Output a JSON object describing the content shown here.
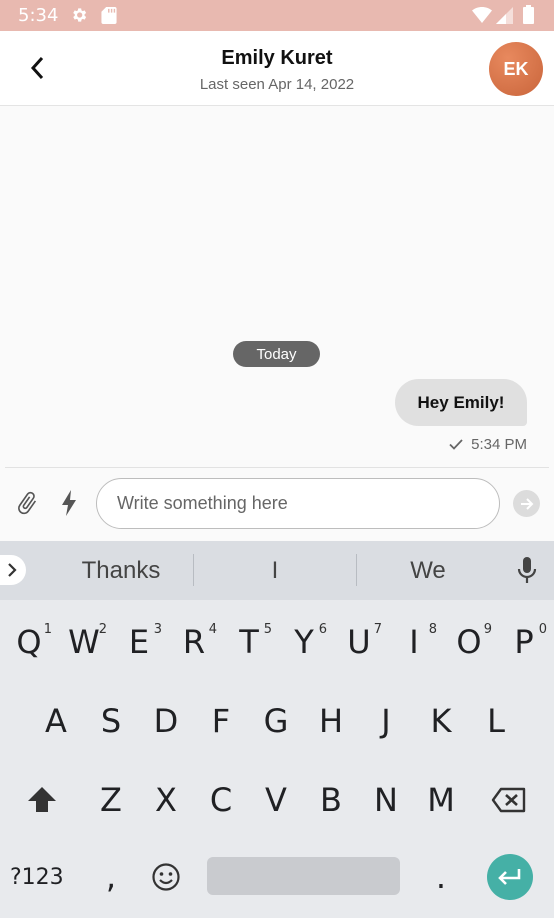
{
  "status_bar": {
    "time": "5:34",
    "icons": [
      "gear-icon",
      "sd-card-icon",
      "wifi-icon",
      "signal-icon",
      "battery-icon"
    ],
    "background": "#e8b9b0"
  },
  "header": {
    "back_icon": "chevron-left-icon",
    "contact_name": "Emily Kuret",
    "last_seen": "Last seen Apr 14, 2022",
    "avatar_initials": "EK",
    "avatar_color": "#d5714a"
  },
  "chat": {
    "date_separator": "Today",
    "messages": [
      {
        "text": "Hey Emily!",
        "time": "5:34 PM",
        "status_icon": "check-icon",
        "outgoing": true
      }
    ]
  },
  "composer": {
    "attach_icon": "paperclip-icon",
    "quick_reply_icon": "lightning-icon",
    "placeholder": "Write something here",
    "value": "",
    "send_icon": "arrow-right-icon"
  },
  "keyboard": {
    "suggestions": [
      "Thanks",
      "I",
      "We"
    ],
    "expand_icon": "chevron-right-icon",
    "mic_icon": "microphone-icon",
    "row1": [
      {
        "key": "Q",
        "hint": "1"
      },
      {
        "key": "W",
        "hint": "2"
      },
      {
        "key": "E",
        "hint": "3"
      },
      {
        "key": "R",
        "hint": "4"
      },
      {
        "key": "T",
        "hint": "5"
      },
      {
        "key": "Y",
        "hint": "6"
      },
      {
        "key": "U",
        "hint": "7"
      },
      {
        "key": "I",
        "hint": "8"
      },
      {
        "key": "O",
        "hint": "9"
      },
      {
        "key": "P",
        "hint": "0"
      }
    ],
    "row2": [
      "A",
      "S",
      "D",
      "F",
      "G",
      "H",
      "J",
      "K",
      "L"
    ],
    "row3": [
      "Z",
      "X",
      "C",
      "V",
      "B",
      "N",
      "M"
    ],
    "shift_icon": "shift-icon",
    "backspace_icon": "backspace-icon",
    "symbols_label": "?123",
    "comma": ",",
    "emoji_icon": "emoji-icon",
    "period": ".",
    "enter_icon": "enter-icon",
    "accent_color": "#45b0a6"
  }
}
